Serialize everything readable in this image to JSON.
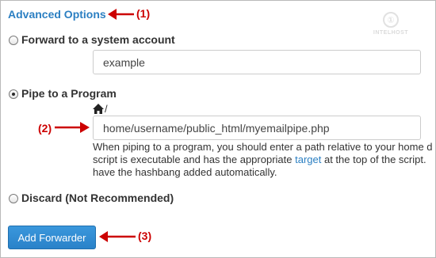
{
  "advanced": {
    "label": "Advanced Options",
    "caret_icon": "caret-down-icon"
  },
  "annotations": {
    "one": "(1)",
    "two": "(2)",
    "three": "(3)",
    "arrow_color": "#cc0000"
  },
  "watermark": {
    "mark": "①",
    "text": "INTELHOST"
  },
  "forward": {
    "label": "Forward to a system account",
    "selected": false,
    "value": "example"
  },
  "pipe": {
    "label": "Pipe to a Program",
    "selected": true,
    "home_icon": "home-icon",
    "slash": "/",
    "value": "home/username/public_html/myemailpipe.php",
    "help": {
      "line1": "When piping to a program, you should enter a path relative to your home d",
      "line2_before": "script is executable and has the appropriate ",
      "link": "target",
      "line2_after": " at the top of the script.",
      "line3": "have the hashbang added automatically."
    }
  },
  "discard": {
    "label": "Discard (Not Recommended)",
    "selected": false
  },
  "submit": {
    "label": "Add Forwarder"
  },
  "colors": {
    "link": "#2b7fc2",
    "button": "#2a82c9",
    "annotation": "#cc0000"
  }
}
